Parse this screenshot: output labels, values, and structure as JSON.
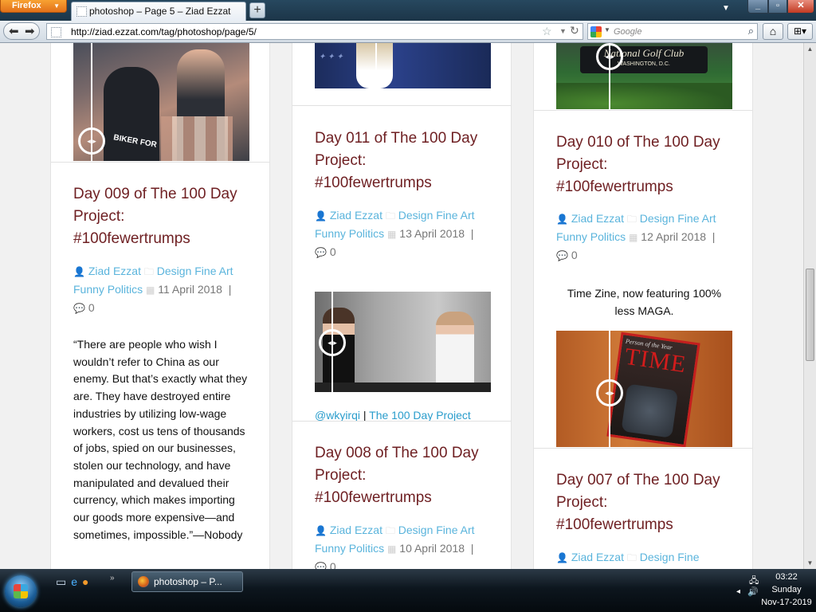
{
  "browser": {
    "menu_button": "Firefox",
    "tab_title": "photoshop – Page 5 – Ziad Ezzat",
    "url": "http://ziad.ezzat.com/tag/photoshop/page/5/",
    "search_placeholder": "Google"
  },
  "columns": [
    {
      "post": {
        "title": "Day 009 of The 100 Day Project: #100fewertrumps",
        "author": "Ziad Ezzat",
        "categories": "Design Fine Art Funny Politics",
        "date": "11 April 2018",
        "comments": "0",
        "excerpt": "“There are people who wish I wouldn’t refer to China as our enemy. But that’s exactly what they are. They have destroyed entire industries by utilizing low-wage workers, cost us tens of thousands of jobs, spied on our businesses, stolen our technology, and have manipulated and devalued their currency, which makes importing our goods more expensive—and sometimes, impossible.”—Nobody"
      }
    },
    {
      "post": {
        "title": "Day 011 of The 100 Day Project: #100fewertrumps",
        "author": "Ziad Ezzat",
        "categories": "Design Fine Art Funny Politics",
        "date": "13 April 2018",
        "comments": "0"
      },
      "links": {
        "user": "@wkyirqi",
        "separator": "|",
        "project": "The 100 Day Project"
      },
      "post2": {
        "title": "Day 008 of The 100 Day Project: #100fewertrumps",
        "author": "Ziad Ezzat",
        "categories": "Design Fine Art Funny Politics",
        "date": "10 April 2018",
        "comments": "0"
      }
    },
    {
      "post": {
        "title": "Day 010 of The 100 Day Project: #100fewertrumps",
        "author": "Ziad Ezzat",
        "categories": "Design Fine Art Funny Politics",
        "date": "12 April 2018",
        "comments": "0"
      },
      "caption": "Time Zine, now featuring 100% less MAGA.",
      "sign": {
        "line1": "National Golf Club",
        "line2": "WASHINGTON, D.C."
      },
      "magazine": {
        "masthead": "TIME",
        "kicker": "Person of the Year"
      },
      "post2": {
        "title": "Day 007 of The 100 Day Project: #100fewertrumps",
        "author": "Ziad Ezzat",
        "categories": "Design Fine"
      }
    }
  ],
  "images": {
    "crowd_shirt": "BIKER FOR"
  },
  "taskbar": {
    "task_label": "photoshop – P...",
    "time": "03:22",
    "day": "Sunday",
    "date": "Nov-17-2019"
  },
  "colors": {
    "title": "#6e1f22",
    "link": "#5ab4dc",
    "accent_link": "#2a9dcc"
  },
  "icons": [
    "author-icon",
    "folder-icon",
    "calendar-icon",
    "comment-icon",
    "compare-slider-icon"
  ]
}
